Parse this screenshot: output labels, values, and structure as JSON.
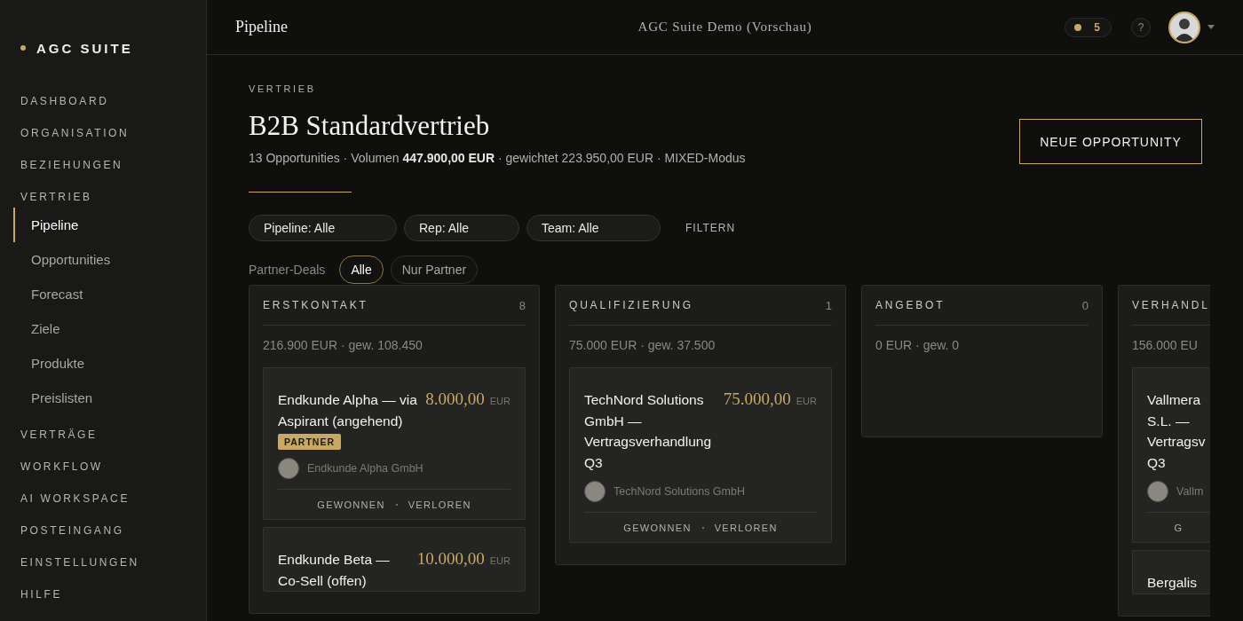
{
  "brand": {
    "name": "AGC SUITE"
  },
  "sidebar": {
    "items": [
      {
        "label": "DASHBOARD",
        "selected": false
      },
      {
        "label": "ORGANISATION",
        "selected": false
      },
      {
        "label": "BEZIEHUNGEN",
        "selected": false
      },
      {
        "label": "VERTRIEB",
        "selected": false,
        "children": [
          {
            "label": "Pipeline",
            "selected": true
          },
          {
            "label": "Opportunities",
            "selected": false
          },
          {
            "label": "Forecast",
            "selected": false
          },
          {
            "label": "Ziele",
            "selected": false
          },
          {
            "label": "Produkte",
            "selected": false
          },
          {
            "label": "Preislisten",
            "selected": false
          }
        ]
      },
      {
        "label": "VERTRÄGE",
        "selected": false
      },
      {
        "label": "WORKFLOW",
        "selected": false
      },
      {
        "label": "AI WORKSPACE",
        "selected": false
      },
      {
        "label": "POSTEINGANG",
        "selected": false
      },
      {
        "label": "EINSTELLUNGEN",
        "selected": false
      },
      {
        "label": "HILFE",
        "selected": false
      }
    ]
  },
  "topbar": {
    "page_title": "Pipeline",
    "workspace": "AGC Suite Demo (Vorschau)",
    "credits": "5",
    "help": "?"
  },
  "header": {
    "eyebrow": "VERTRIEB",
    "title": "B2B Standardvertrieb",
    "summary": "13 Opportunities · Volumen **447.900,00 EUR** · gewichtet 223.950,00 EUR · MIXED-Modus",
    "button": "NEUE OPPORTUNITY"
  },
  "filters": {
    "selects": [
      "Pipeline: Alle",
      "Rep: Alle",
      "Team: Alle"
    ],
    "apply": "FILTERN",
    "partner_label": "Partner-Deals",
    "partner_options": [
      {
        "label": "Alle",
        "selected": true
      },
      {
        "label": "Nur Partner",
        "selected": false
      }
    ]
  },
  "columns": [
    {
      "kind": "full",
      "title": "ERSTKONTAKT",
      "count": "8",
      "summary": "216.900 EUR · gew. 108.450",
      "cards": [
        {
          "title": [
            "Endkunde Alpha — via",
            "Aspirant (angehend)"
          ],
          "amount": "8.000,00",
          "currency": "EUR",
          "badge": "PARTNER",
          "contact": "Endkunde Alpha GmbH",
          "actions": [
            "GEWONNEN",
            "VERLOREN"
          ]
        },
        {
          "title": [
            "Endkunde Beta —",
            "Co-Sell (offen)"
          ],
          "amount": "10.000,00",
          "currency": "EUR"
        }
      ]
    },
    {
      "kind": "full",
      "title": "QUALIFIZIERUNG",
      "count": "1",
      "summary": "75.000 EUR · gew. 37.500",
      "cards": [
        {
          "title": [
            "TechNord Solutions",
            "GmbH —",
            "Vertragsverhandlung",
            "Q3"
          ],
          "amount": "75.000,00",
          "currency": "EUR",
          "contact": "TechNord Solutions GmbH",
          "actions": [
            "GEWONNEN",
            "VERLOREN"
          ]
        }
      ]
    },
    {
      "kind": "full",
      "title": "ANGEBOT",
      "count": "0",
      "summary": "0 EUR · gew. 0"
    },
    {
      "kind": "clipped",
      "title": "VERHANDL",
      "summary": "156.000 EU",
      "cards": [
        {
          "title": [
            "Vallmera",
            "S.L. —",
            "Vertragsv",
            "Q3"
          ],
          "contact": "Vallm",
          "actions": [
            "G"
          ]
        },
        {
          "title": [
            "Bergalis"
          ]
        }
      ]
    }
  ]
}
